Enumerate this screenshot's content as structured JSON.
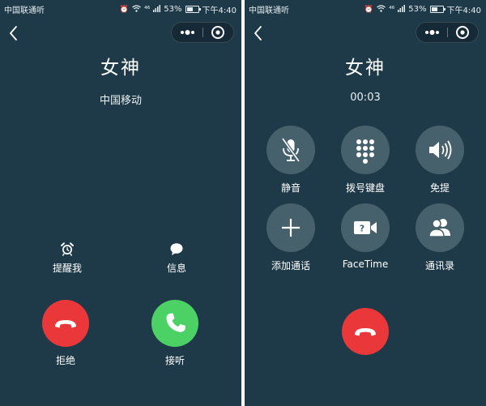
{
  "status_bar": {
    "carrier": "中国联通",
    "carrier_suffix": "听",
    "network": "⁴⁶",
    "battery": "53%",
    "battery_level": 0.53,
    "time": "下午4:40"
  },
  "incoming_call": {
    "contact_name": "女神",
    "carrier_label": "中国移动",
    "remind_label": "提醒我",
    "message_label": "信息",
    "decline_label": "拒绝",
    "answer_label": "接听"
  },
  "active_call": {
    "contact_name": "女神",
    "duration": "00:03",
    "buttons": [
      {
        "label": "静音",
        "icon": "microphone-muted-icon"
      },
      {
        "label": "拨号键盘",
        "icon": "keypad-icon"
      },
      {
        "label": "免提",
        "icon": "speaker-icon"
      },
      {
        "label": "添加通话",
        "icon": "plus-icon"
      },
      {
        "label": "FaceTime",
        "icon": "facetime-icon"
      },
      {
        "label": "通讯录",
        "icon": "contacts-icon"
      }
    ]
  },
  "colors": {
    "background": "#1e3a48",
    "decline": "#e9373a",
    "answer": "#4cd264",
    "grid_button": "#47616c"
  }
}
